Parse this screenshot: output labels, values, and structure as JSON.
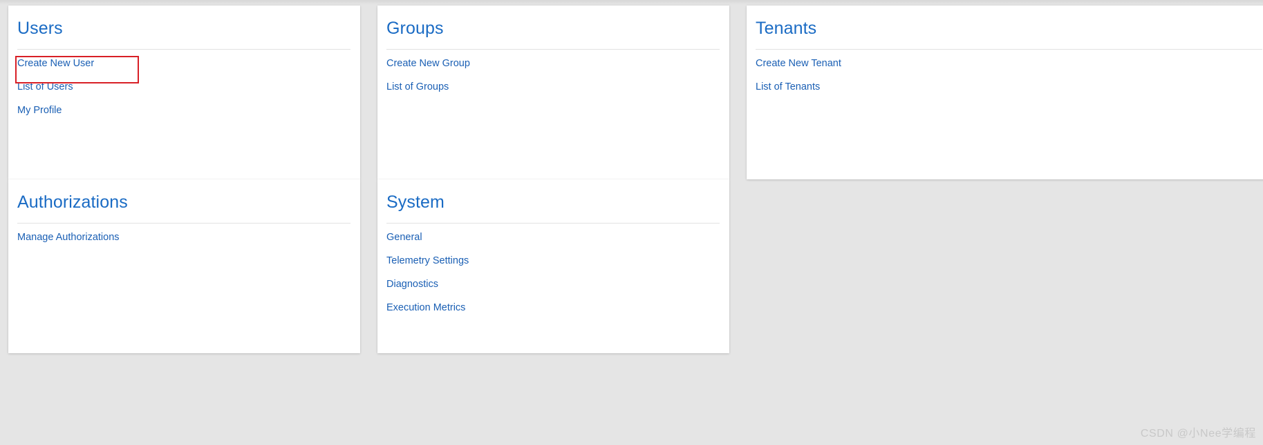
{
  "page": {
    "background_color": "#e5e5e5",
    "heading_color": "#1a6bc4",
    "link_color": "#1a5fb4",
    "annotation_color": "#d81f26"
  },
  "cards": [
    {
      "id": "users",
      "title": "Users",
      "links": [
        {
          "id": "create-new-user",
          "label": "Create New User",
          "highlighted": true
        },
        {
          "id": "list-of-users",
          "label": "List of Users",
          "highlighted": false
        },
        {
          "id": "my-profile",
          "label": "My Profile",
          "highlighted": false
        }
      ]
    },
    {
      "id": "groups",
      "title": "Groups",
      "links": [
        {
          "id": "create-new-group",
          "label": "Create New Group",
          "highlighted": false
        },
        {
          "id": "list-of-groups",
          "label": "List of Groups",
          "highlighted": false
        }
      ]
    },
    {
      "id": "tenants",
      "title": "Tenants",
      "links": [
        {
          "id": "create-new-tenant",
          "label": "Create New Tenant",
          "highlighted": false
        },
        {
          "id": "list-of-tenants",
          "label": "List of Tenants",
          "highlighted": false
        }
      ]
    },
    {
      "id": "authorizations",
      "title": "Authorizations",
      "links": [
        {
          "id": "manage-authorizations",
          "label": "Manage Authorizations",
          "highlighted": false
        }
      ]
    },
    {
      "id": "system",
      "title": "System",
      "links": [
        {
          "id": "general",
          "label": "General",
          "highlighted": false
        },
        {
          "id": "telemetry-settings",
          "label": "Telemetry Settings",
          "highlighted": false
        },
        {
          "id": "diagnostics",
          "label": "Diagnostics",
          "highlighted": false
        },
        {
          "id": "execution-metrics",
          "label": "Execution Metrics",
          "highlighted": false
        }
      ]
    }
  ],
  "watermark": {
    "text": "CSDN @小Nee学编程"
  }
}
